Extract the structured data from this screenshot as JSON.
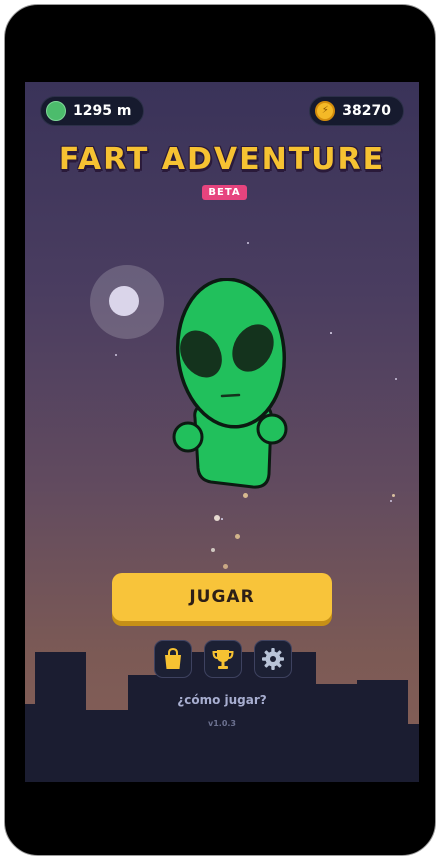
{
  "hud": {
    "distance": "1295 m",
    "distance_icon": "green-orb-icon",
    "coins": "38270",
    "coin_icon": "coin-icon"
  },
  "title": "FART ADVENTURE",
  "badge": "BETA",
  "play_label": "JUGAR",
  "menu_icons": [
    "shop-bag-icon",
    "trophy-icon",
    "settings-gear-icon"
  ],
  "how_to_play": "¿cómo jugar?",
  "version": "v1.0.3",
  "colors": {
    "title_yellow": "#f6c232",
    "play_button": "#f8c43a",
    "badge_pink": "#e6447e",
    "alien_green": "#1fc15c",
    "city_silhouette": "#1b1d31"
  }
}
